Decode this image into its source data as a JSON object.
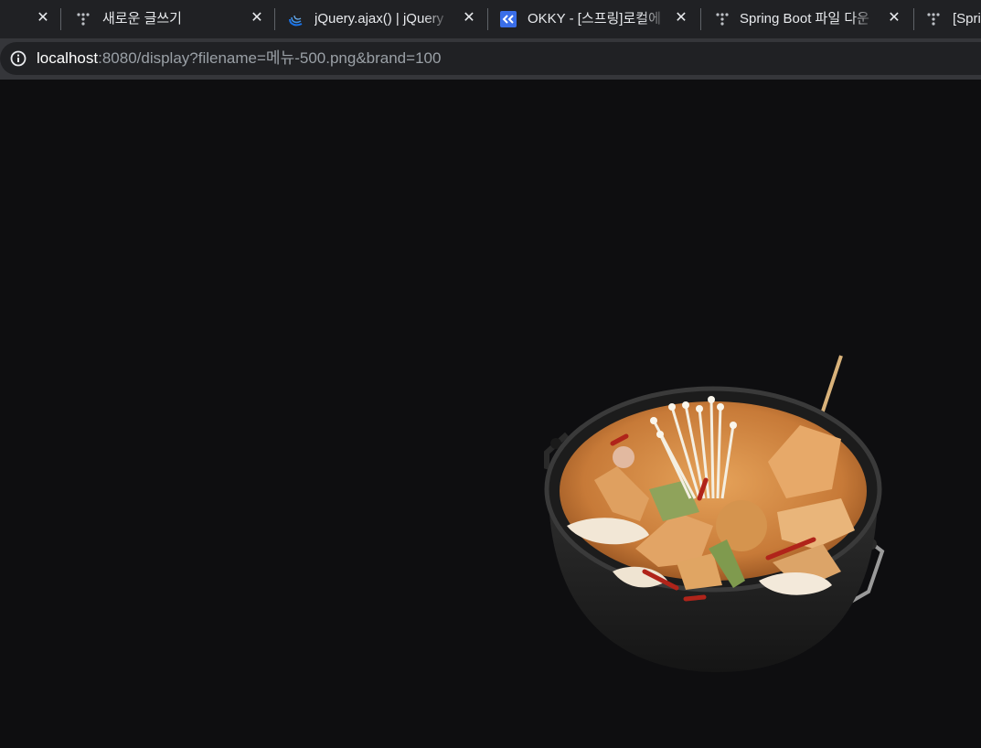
{
  "tabs": [
    {
      "title": "새로운 글쓰기",
      "icon": "dots-logo-icon"
    },
    {
      "title": "jQuery.ajax() | jQuery",
      "icon": "jquery-logo-icon"
    },
    {
      "title": "OKKY - [스프링]로컬에",
      "icon": "okky-logo-icon"
    },
    {
      "title": "Spring Boot 파일 다운",
      "icon": "dots-logo-icon"
    },
    {
      "title": "[Spri",
      "icon": "dots-logo-icon"
    }
  ],
  "address_bar": {
    "host": "localhost",
    "rest": ":8080/display?filename=메뉴-500.png&brand=100"
  },
  "page": {
    "image_subject": "odeng-tang-hotpot"
  },
  "colors": {
    "tabstrip": "#202124",
    "toolbar": "#35363a",
    "page_background": "#0e0e10"
  }
}
